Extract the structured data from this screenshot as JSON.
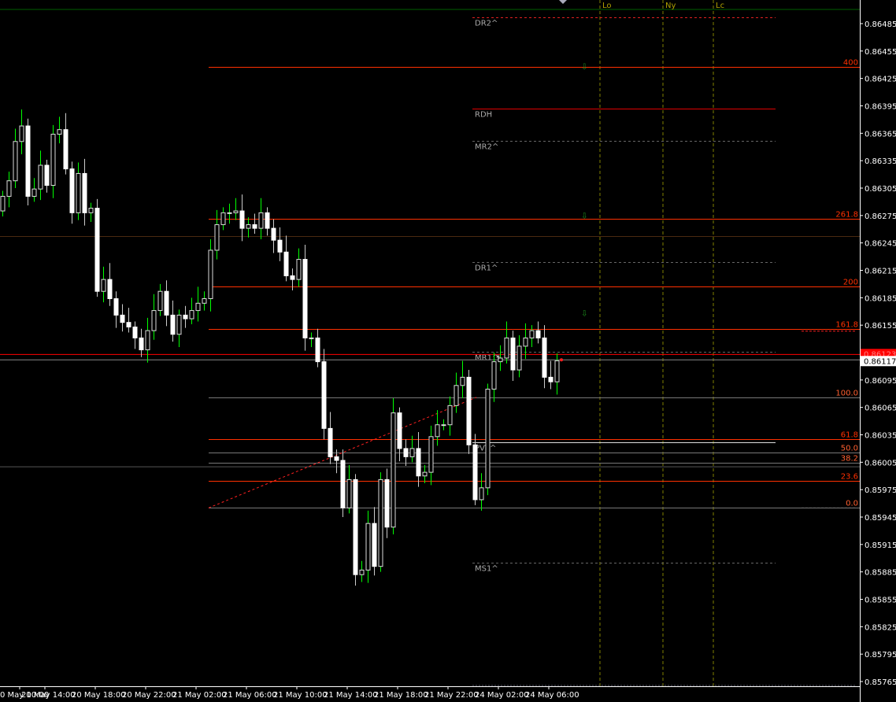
{
  "chart_data": {
    "type": "candlestick",
    "symbol_timeframe": "",
    "y_range": [
      0.85765,
      0.86485
    ],
    "y_ticks": [
      "0.86485",
      "0.86455",
      "0.86425",
      "0.86395",
      "0.86365",
      "0.86335",
      "0.86305",
      "0.86275",
      "0.86245",
      "0.86215",
      "0.86185",
      "0.86155",
      "0.86125",
      "0.86095",
      "0.86065",
      "0.86035",
      "0.86005",
      "0.85975",
      "0.85945",
      "0.85915",
      "0.85885",
      "0.85855",
      "0.85825",
      "0.85795",
      "0.85765"
    ],
    "x_ticks": [
      "0 May 10:00",
      "20 May 14:00",
      "20 May 18:00",
      "20 May 22:00",
      "21 May 02:00",
      "21 May 06:00",
      "21 May 10:00",
      "21 May 14:00",
      "21 May 18:00",
      "21 May 22:00",
      "24 May 02:00",
      "24 May 06:00"
    ],
    "first_open": 0.8628,
    "closes": [
      0.86296,
      0.86313,
      0.86356,
      0.86373,
      0.86296,
      0.86304,
      0.8633,
      0.86308,
      0.86364,
      0.86369,
      0.86326,
      0.86278,
      0.86321,
      0.86278,
      0.86283,
      0.86192,
      0.86205,
      0.86184,
      0.86166,
      0.86158,
      0.86153,
      0.86141,
      0.86128,
      0.86149,
      0.86171,
      0.86192,
      0.86166,
      0.86145,
      0.86166,
      0.86162,
      0.86171,
      0.86179,
      0.86184,
      0.86237,
      0.86265,
      0.86278,
      0.86278,
      0.8628,
      0.86261,
      0.86265,
      0.86261,
      0.86278,
      0.86261,
      0.86248,
      0.86235,
      0.86209,
      0.86205,
      0.86227,
      0.86141,
      0.86141,
      0.86115,
      0.86042,
      0.86011,
      0.86007,
      0.85955,
      0.85986,
      0.85882,
      0.85887,
      0.85938,
      0.85891,
      0.85986,
      0.85934,
      0.86059,
      0.8602,
      0.86011,
      0.8602,
      0.8599,
      0.85994,
      0.86033,
      0.86046,
      0.86046,
      0.86067,
      0.86089,
      0.86098,
      0.86024,
      0.85964,
      0.85977,
      0.86085,
      0.86115,
      0.86119,
      0.86141,
      0.86106,
      0.86132,
      0.86141,
      0.86149,
      0.86141,
      0.86098,
      0.86093,
      0.86116
    ],
    "bid_price": "0.86117",
    "ask_price": "0.86123",
    "levels": [
      {
        "label": "DR2^",
        "price": 0.86492,
        "style": "dashed",
        "color": "#e02020",
        "side": "left"
      },
      {
        "label": "400",
        "price": 0.86438,
        "style": "solid",
        "color": "#ff3000",
        "side": "right"
      },
      {
        "label": "RDH",
        "price": 0.86392,
        "style": "solid",
        "color": "#e00000",
        "side": "left"
      },
      {
        "label": "MR2^",
        "price": 0.86357,
        "style": "dashed",
        "color": "#666666",
        "side": "left"
      },
      {
        "label": "261.8",
        "price": 0.86271,
        "style": "solid",
        "color": "#ff3000",
        "side": "right"
      },
      {
        "label": "DR1^",
        "price": 0.86224,
        "style": "dashed",
        "color": "#666666",
        "side": "left"
      },
      {
        "label": "200",
        "price": 0.86197,
        "style": "solid",
        "color": "#ff3000",
        "side": "right"
      },
      {
        "label": "161.8",
        "price": 0.86151,
        "style": "solid",
        "color": "#ff3000",
        "side": "right"
      },
      {
        "label": "MR1^",
        "price": 0.86126,
        "style": "dashed",
        "color": "#666666",
        "side": "left"
      },
      {
        "label": "100.0",
        "price": 0.86076,
        "style": "solid",
        "color": "#777777",
        "side": "right"
      },
      {
        "label": "61.8",
        "price": 0.8603,
        "style": "solid",
        "color": "#ff3000",
        "side": "right"
      },
      {
        "label": "PVT^",
        "price": 0.86027,
        "style": "solid",
        "color": "#dddddd",
        "side": "left"
      },
      {
        "label": "50.0",
        "price": 0.86016,
        "style": "solid",
        "color": "#777777",
        "side": "right"
      },
      {
        "label": "38.2",
        "price": 0.86004,
        "style": "solid",
        "color": "#777777",
        "side": "right"
      },
      {
        "label": "23.6",
        "price": 0.85985,
        "style": "solid",
        "color": "#ff3000",
        "side": "right"
      },
      {
        "label": "0.0",
        "price": 0.85955,
        "style": "solid",
        "color": "#777777",
        "side": "right"
      },
      {
        "label": "MS1^",
        "price": 0.85895,
        "style": "dashed",
        "color": "#666666",
        "side": "left"
      }
    ],
    "sessions": [
      "Lo",
      "Ny",
      "Lc"
    ],
    "colors": {
      "background": "#000000",
      "bear": "#ffffff",
      "bull": "#000000",
      "wick": "#00ff00",
      "axis": "#ffffff",
      "session": "#808000"
    }
  }
}
